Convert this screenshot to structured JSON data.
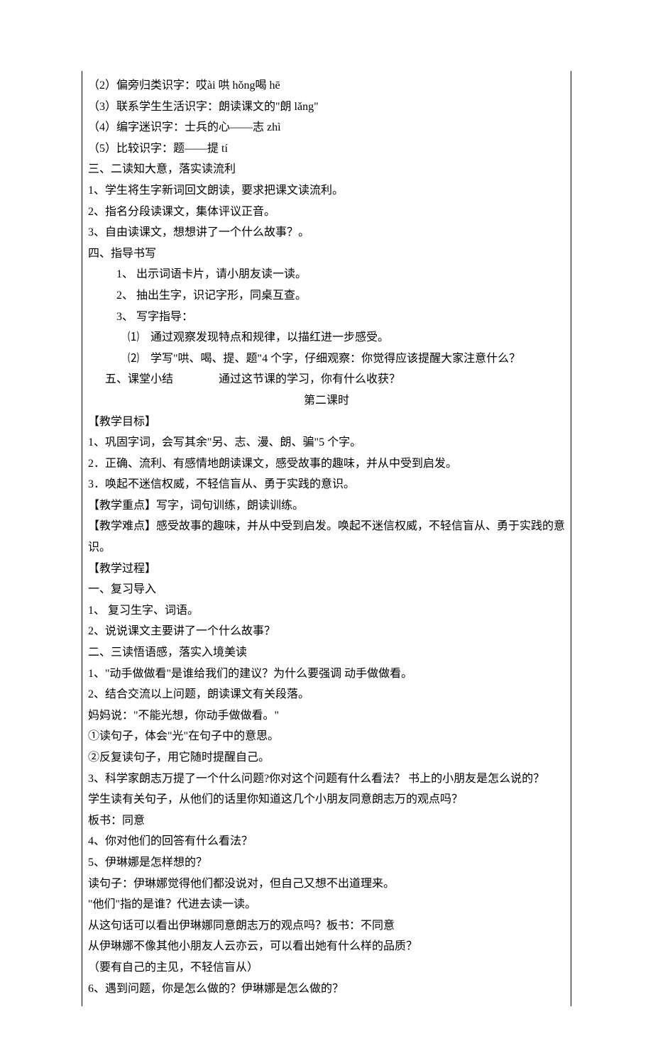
{
  "lines": [
    {
      "cls": "",
      "text": "（2）偏旁归类识字：哎ài 哄 hǒng喝 hē"
    },
    {
      "cls": "",
      "text": "（3）联系学生生活识字：朗读课文的\"朗 lǎng\""
    },
    {
      "cls": "",
      "text": "（4）编字迷识字：士兵的心——志 zhì"
    },
    {
      "cls": "",
      "text": "（5）比较识字：题——提 tí"
    },
    {
      "cls": "",
      "text": "三、二读知大意，落实读流利"
    },
    {
      "cls": "",
      "text": "1、学生将生字新词回文朗读，要求把课文读流利。"
    },
    {
      "cls": "",
      "text": "2、指名分段读课文，集体评议正音。"
    },
    {
      "cls": "",
      "text": "3、自由读课文，想想讲了一个什么故事？。"
    },
    {
      "cls": "",
      "text": "四、指导书写"
    },
    {
      "cls": "indent1",
      "text": "1、 出示词语卡片，请小朋友读一读。"
    },
    {
      "cls": "indent1",
      "text": "2、 抽出生字，识记字形，同桌互查。"
    },
    {
      "cls": "indent1",
      "text": "3、 写字指导："
    },
    {
      "cls": "indent2",
      "text": "⑴　通过观察发现特点和规律，以描红进一步感受。"
    },
    {
      "cls": "indent2",
      "text": "⑵　学写\"哄、喝、提、题\"4 个字，仔细观察：你觉得应该提醒大家注意什么？"
    },
    {
      "cls": "indent3",
      "text": "五、课堂小结　　　　通过这节课的学习，你有什么收获？"
    },
    {
      "cls": "center",
      "text": "第二课时"
    },
    {
      "cls": "",
      "text": "【教学目标】"
    },
    {
      "cls": "",
      "text": "1、巩固字词，会写其余\"另、志、漫、朗、骗\"5 个字。"
    },
    {
      "cls": "",
      "text": "2．正确、流利、有感情地朗读课文，感受故事的趣味，并从中受到启发。"
    },
    {
      "cls": "",
      "text": "3．唤起不迷信权威，不轻信盲从、勇于实践的意识。"
    },
    {
      "cls": "",
      "text": "【教学重点】写字，词句训练，朗读训练。"
    },
    {
      "cls": "",
      "text": "【教学难点】感受故事的趣味，并从中受到启发。唤起不迷信权威，不轻信盲从、勇于实践的意识。"
    },
    {
      "cls": "",
      "text": "【教学过程】"
    },
    {
      "cls": "",
      "text": "一、复习导入"
    },
    {
      "cls": "",
      "text": "1、 复习生字、词语。"
    },
    {
      "cls": "",
      "text": "2、说说课文主要讲了一个什么故事？"
    },
    {
      "cls": "",
      "text": "二、三读悟语感，落实入境美读"
    },
    {
      "cls": "",
      "text": "1、\"动手做做看\"是谁给我们的建议？为什么要强调 动手做做看。"
    },
    {
      "cls": "",
      "text": "2、结合交流以上问题，朗读课文有关段落。"
    },
    {
      "cls": "",
      "text": "妈妈说：\"不能光想，你动手做做看。\""
    },
    {
      "cls": "",
      "text": "①读句子，体会\"光\"在句子中的意思。"
    },
    {
      "cls": "",
      "text": "②反复读句子，用它随时提醒自己。"
    },
    {
      "cls": "",
      "text": "3、科学家朗志万提了一个什么问题?你对这个问题有什么看法？ 书上的小朋友是怎么说的？"
    },
    {
      "cls": "",
      "text": " 学生读有关句子，从他们的话里你知道这几个小朋友同意朗志万的观点吗？"
    },
    {
      "cls": "",
      "text": "板书：同意"
    },
    {
      "cls": "",
      "text": " 4、你对他们的回答有什么看法？"
    },
    {
      "cls": "",
      "text": " 5、伊琳娜是怎样想的？"
    },
    {
      "cls": "",
      "text": "读句子：伊琳娜觉得他们都没说对，但自己又想不出道理来。"
    },
    {
      "cls": "",
      "text": "\"他们\"指的是谁？代进去读一读。"
    },
    {
      "cls": "",
      "text": "从这句话可以看出伊琳娜同意朗志万的观点吗？板书：不同意"
    },
    {
      "cls": "",
      "text": "从伊琳娜不像其他小朋友人云亦云，可以看出她有什么样的品质？"
    },
    {
      "cls": "",
      "text": "（要有自己的主见，不轻信盲从）"
    },
    {
      "cls": "",
      "text": " 6、遇到问题，你是怎么做的？伊琳娜是怎么做的？"
    }
  ]
}
